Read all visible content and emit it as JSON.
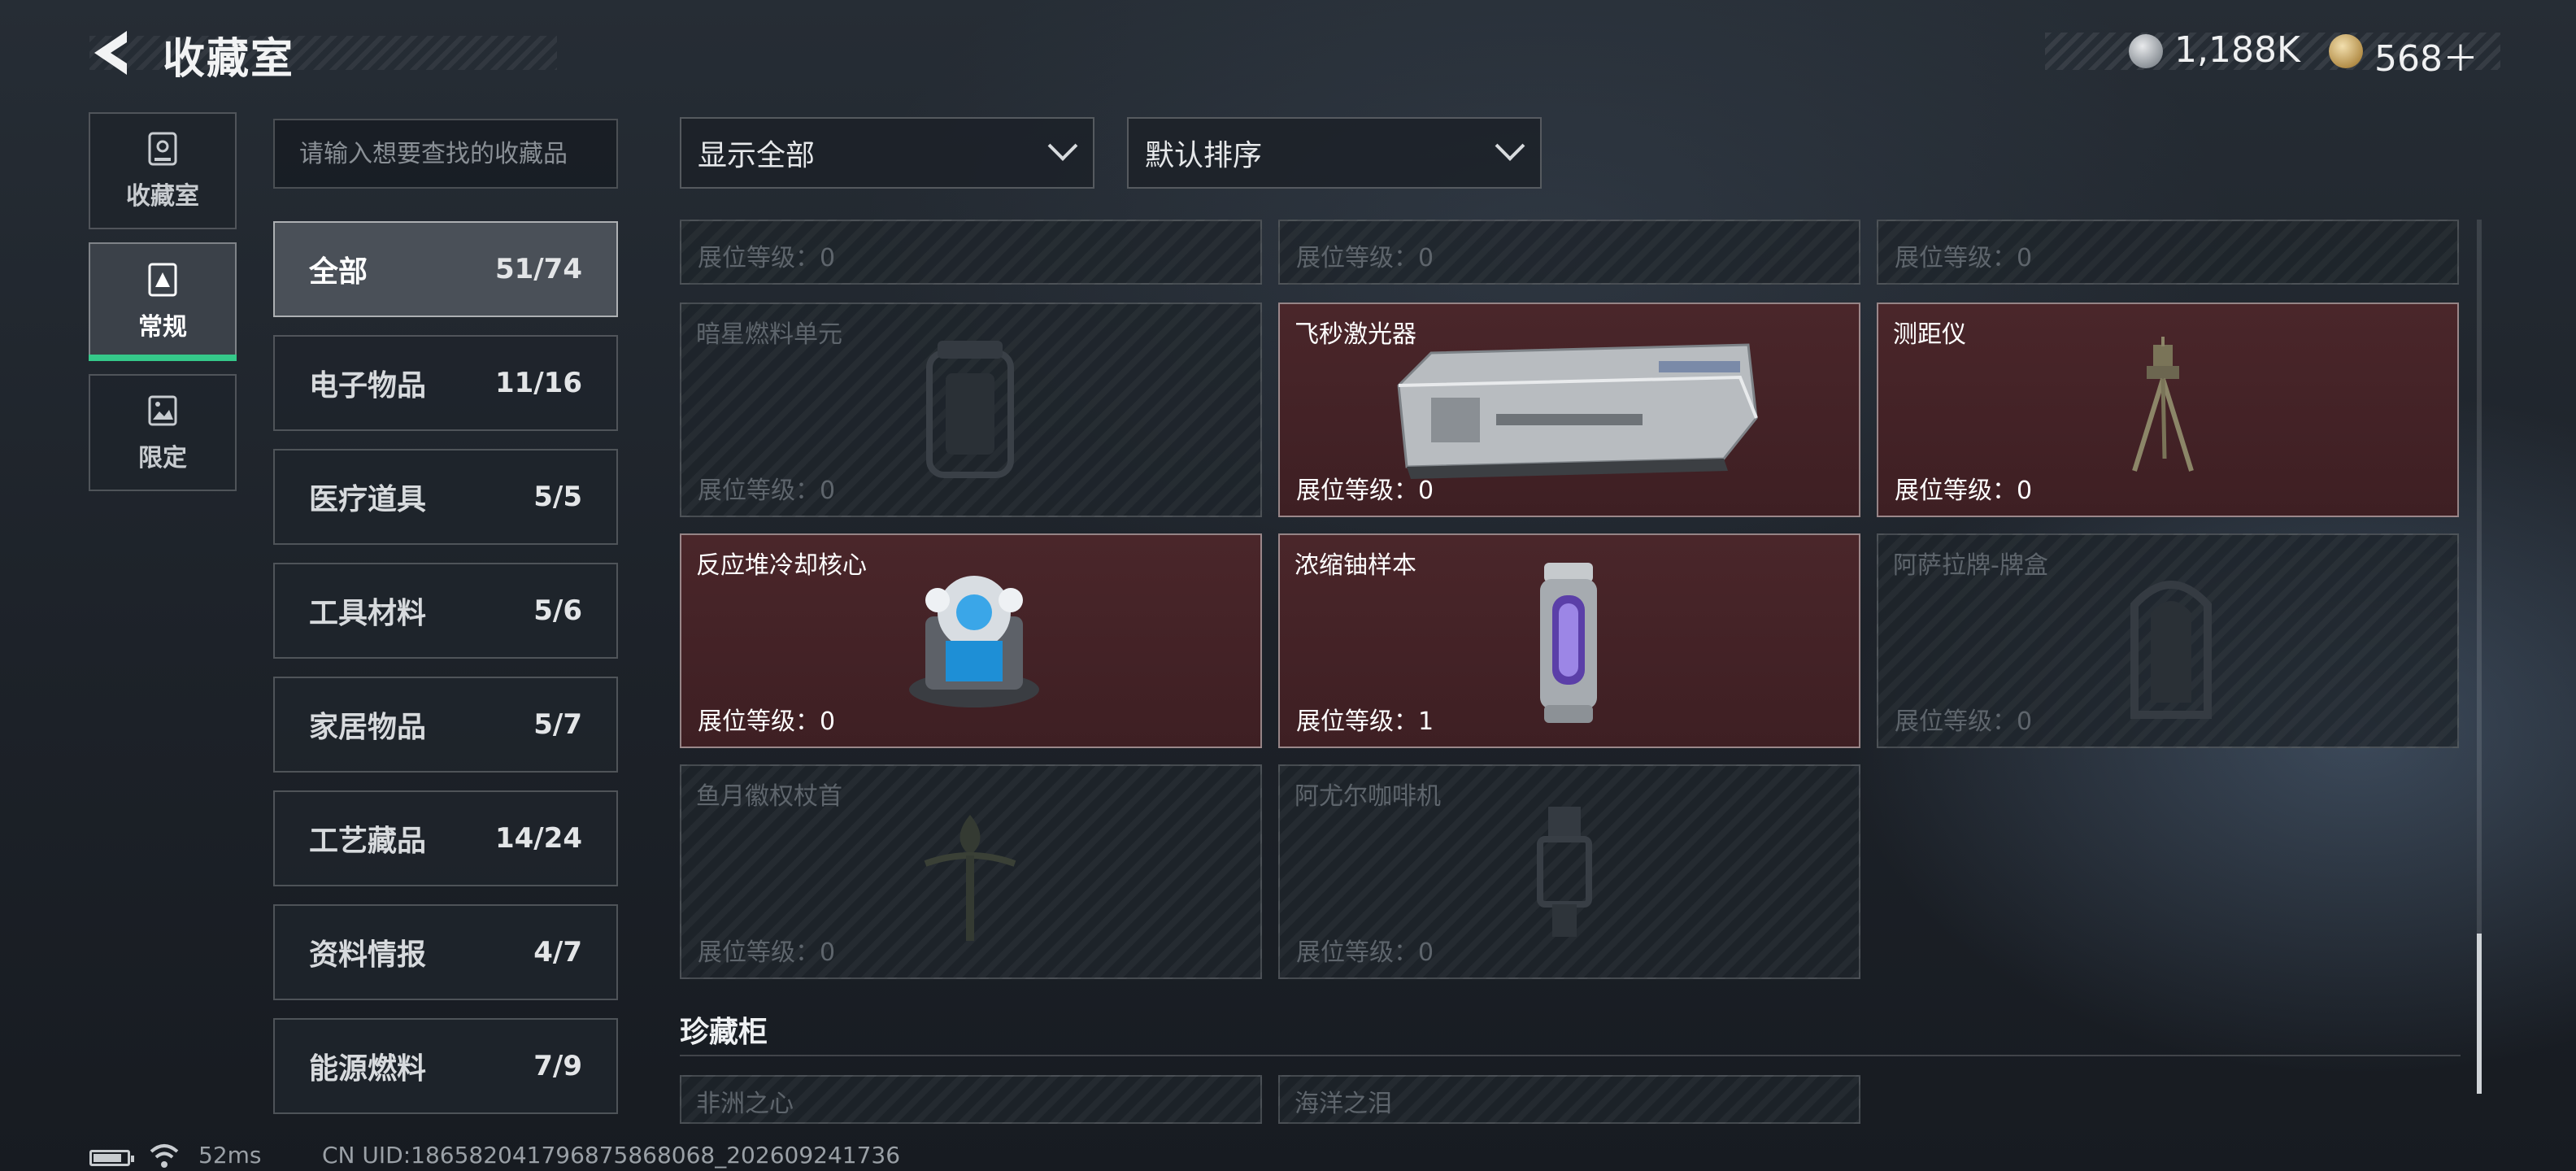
{
  "header": {
    "title": "收藏室"
  },
  "currency": {
    "silver": "1,188K",
    "gold": "568＋"
  },
  "rail": {
    "items": [
      {
        "label": "收藏室",
        "icon": "vault-icon"
      },
      {
        "label": "常规",
        "icon": "badge-icon"
      },
      {
        "label": "限定",
        "icon": "landscape-icon"
      }
    ],
    "active": "常规"
  },
  "search": {
    "placeholder": "请输入想要查找的收藏品"
  },
  "categories": [
    {
      "name": "全部",
      "count": "51/74",
      "active": true
    },
    {
      "name": "电子物品",
      "count": "11/16"
    },
    {
      "name": "医疗道具",
      "count": "5/5"
    },
    {
      "name": "工具材料",
      "count": "5/6"
    },
    {
      "name": "家居物品",
      "count": "5/7"
    },
    {
      "name": "工艺藏品",
      "count": "14/24"
    },
    {
      "name": "资料情报",
      "count": "4/7"
    },
    {
      "name": "能源燃料",
      "count": "7/9"
    }
  ],
  "filters": {
    "show": "显示全部",
    "sort": "默认排序"
  },
  "cards": [
    {
      "name": "",
      "level": "展位等级：0",
      "owned": false
    },
    {
      "name": "",
      "level": "展位等级：0",
      "owned": false
    },
    {
      "name": "",
      "level": "展位等级：0",
      "owned": false
    },
    {
      "name": "暗星燃料单元",
      "level": "展位等级：0",
      "owned": false,
      "icon": "fuel-cell-icon"
    },
    {
      "name": "飞秒激光器",
      "level": "展位等级：0",
      "owned": true,
      "icon": "laser-device-icon"
    },
    {
      "name": "测距仪",
      "level": "展位等级：0",
      "owned": true,
      "icon": "tripod-rangefinder-icon"
    },
    {
      "name": "反应堆冷却核心",
      "level": "展位等级：0",
      "owned": true,
      "icon": "reactor-core-icon"
    },
    {
      "name": "浓缩铀样本",
      "level": "展位等级：1",
      "owned": true,
      "icon": "uranium-canister-icon"
    },
    {
      "name": "阿萨拉牌-牌盒",
      "level": "展位等级：0",
      "owned": false,
      "icon": "card-box-icon"
    },
    {
      "name": "鱼月徽权杖首",
      "level": "展位等级：0",
      "owned": false,
      "icon": "scepter-icon"
    },
    {
      "name": "阿尤尔咖啡机",
      "level": "展位等级：0",
      "owned": false,
      "icon": "coffee-machine-icon"
    }
  ],
  "cabinet": {
    "title": "珍藏柜",
    "cards": [
      {
        "name": "非洲之心"
      },
      {
        "name": "海洋之泪"
      }
    ]
  },
  "footer": {
    "ping": "52ms",
    "uid": "CN UID:1865820417968758680​68_202609241736"
  },
  "colors": {
    "owned_bg": "#4a262a",
    "active_green": "#35c98a",
    "background": "#1d2229"
  }
}
